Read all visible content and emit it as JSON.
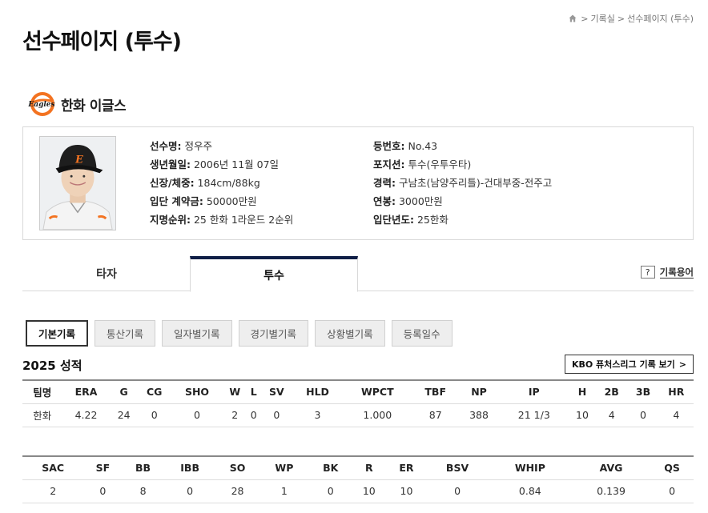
{
  "breadcrumb": {
    "sep1": ">",
    "item1": "기록실",
    "sep2": ">",
    "item2": "선수페이지 (투수)"
  },
  "page_title": "선수페이지 (투수)",
  "team": {
    "name": "한화 이글스",
    "logo_text": "Eagles"
  },
  "profile": {
    "left": [
      {
        "label": "선수명:",
        "value": " 정우주"
      },
      {
        "label": "생년월일:",
        "value": " 2006년 11월 07일"
      },
      {
        "label": "신장/체중:",
        "value": " 184cm/88kg"
      },
      {
        "label": "입단 계약금:",
        "value": " 50000만원"
      },
      {
        "label": "지명순위:",
        "value": " 25 한화 1라운드 2순위"
      }
    ],
    "right": [
      {
        "label": "등번호:",
        "value": " No.43"
      },
      {
        "label": "포지션:",
        "value": " 투수(우투우타)"
      },
      {
        "label": "경력:",
        "value": " 구남초(남양주리틀)-건대부중-전주고"
      },
      {
        "label": "연봉:",
        "value": " 3000만원"
      },
      {
        "label": "입단년도:",
        "value": " 25한화"
      }
    ]
  },
  "tabs": {
    "batter": "타자",
    "pitcher": "투수"
  },
  "glossary": {
    "icon": "?",
    "label": "기록용어"
  },
  "subtabs": [
    "기본기록",
    "통산기록",
    "일자별기록",
    "경기별기록",
    "상황별기록",
    "등록일수"
  ],
  "season_title": "2025 성적",
  "futures_button": {
    "label": "KBO 퓨처스리그 기록 보기",
    "arrow": ">"
  },
  "table1": {
    "headers": [
      "팀명",
      "ERA",
      "G",
      "CG",
      "SHO",
      "W",
      "L",
      "SV",
      "HLD",
      "WPCT",
      "TBF",
      "NP",
      "IP",
      "H",
      "2B",
      "3B",
      "HR"
    ],
    "row": [
      "한화",
      "4.22",
      "24",
      "0",
      "0",
      "2",
      "0",
      "0",
      "3",
      "1.000",
      "87",
      "388",
      "21 1/3",
      "10",
      "4",
      "0",
      "4"
    ]
  },
  "table2": {
    "headers": [
      "SAC",
      "SF",
      "BB",
      "IBB",
      "SO",
      "WP",
      "BK",
      "R",
      "ER",
      "BSV",
      "WHIP",
      "AVG",
      "QS"
    ],
    "row": [
      "2",
      "0",
      "8",
      "0",
      "28",
      "1",
      "0",
      "10",
      "10",
      "0",
      "0.84",
      "0.139",
      "0"
    ]
  },
  "colors": {
    "active_tab": "#0f1e46",
    "team_orange": "#f37321"
  }
}
